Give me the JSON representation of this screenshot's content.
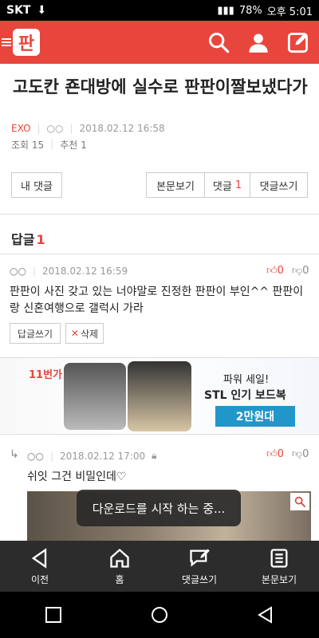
{
  "status": {
    "carrier": "SKT",
    "battery": "78%",
    "time": "오후 5:01",
    "download": "⬇",
    "signal": "▮▮▮"
  },
  "appbar": {
    "logo_text": "판"
  },
  "post": {
    "title": "고도칸 죤대방에 실수로 판판이짤보냈다가",
    "category": "EXO",
    "author": "○○",
    "date": "2018.02.12 16:58",
    "views_label": "조회 15",
    "recommend_label": "추천 1"
  },
  "buttons": {
    "my_comments": "내 댓글",
    "view_body": "본문보기",
    "comments": "댓글",
    "comments_count": "1",
    "write_comment": "댓글쓰기"
  },
  "replies": {
    "heading": "답글",
    "count": "1"
  },
  "comment1": {
    "author": "○○",
    "date": "2018.02.12 16:59",
    "up_count": "0",
    "down_count": "0",
    "body": "판판이 사진 갖고 있는 너야말로 진정한 판판이 부인^^ 판판이랑 신혼여행으로 갤럭시 가라",
    "reply_button": "답글쓰기",
    "delete_button": "삭제"
  },
  "ad": {
    "logo": "11번가",
    "line1": "파워 세일!",
    "line2": "STL 인기 보드복",
    "line3": "2만원대"
  },
  "comment2": {
    "author": "○○",
    "date": "2018.02.12 17:00",
    "up_count": "0",
    "down_count": "0",
    "body": "쉬잇 그건 비밀인데♡"
  },
  "toast": "다운로드를 시작 하는 중...",
  "bottom_nav": {
    "prev": "이전",
    "home": "홈",
    "write": "댓글쓰기",
    "view": "본문보기"
  }
}
